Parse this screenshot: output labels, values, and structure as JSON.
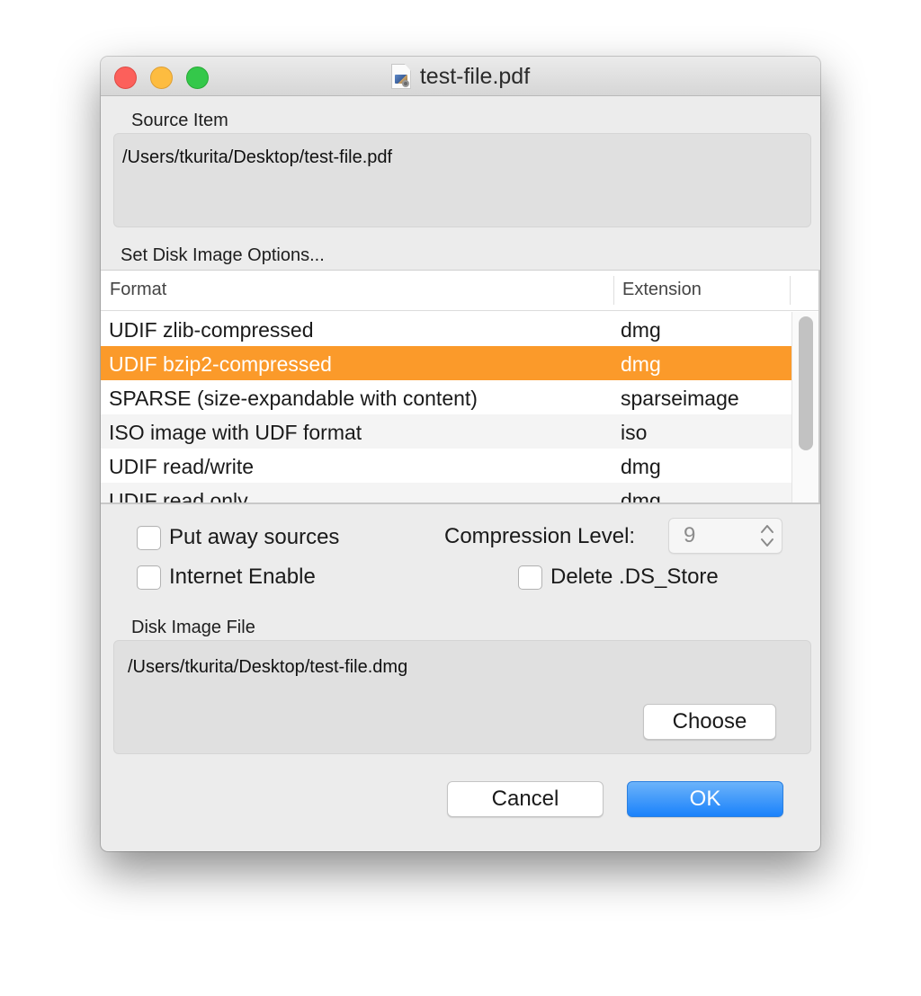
{
  "window": {
    "title": "test-file.pdf",
    "title_icon": "pdf-document-icon",
    "controls": [
      "close",
      "minimize",
      "maximize"
    ]
  },
  "source": {
    "label": "Source Item",
    "path": "/Users/tkurita/Desktop/test-file.pdf"
  },
  "options": {
    "label": "Set Disk Image Options...",
    "table": {
      "columns": [
        "Format",
        "Extension"
      ],
      "rows": [
        {
          "format": "UDIF zlib-compressed",
          "extension": "dmg",
          "selected": false
        },
        {
          "format": "UDIF bzip2-compressed",
          "extension": "dmg",
          "selected": true
        },
        {
          "format": "SPARSE (size-expandable with content)",
          "extension": "sparseimage",
          "selected": false
        },
        {
          "format": "ISO image with UDF format",
          "extension": "iso",
          "selected": false
        },
        {
          "format": "UDIF read/write",
          "extension": "dmg",
          "selected": false
        },
        {
          "format": "UDIF read only",
          "extension": "dmg",
          "selected": false
        }
      ],
      "selection_color": "#fb9a2a"
    },
    "put_away_sources": {
      "label": "Put away sources",
      "checked": false
    },
    "internet_enable": {
      "label": "Internet Enable",
      "checked": false
    },
    "delete_ds_store": {
      "label": "Delete .DS_Store",
      "checked": false
    },
    "compression_level": {
      "label": "Compression Level:",
      "value": "9"
    }
  },
  "destination": {
    "label": "Disk Image File",
    "path": "/Users/tkurita/Desktop/test-file.dmg",
    "choose_label": "Choose"
  },
  "footer": {
    "cancel_label": "Cancel",
    "ok_label": "OK",
    "accent_color": "#1a82fb"
  }
}
